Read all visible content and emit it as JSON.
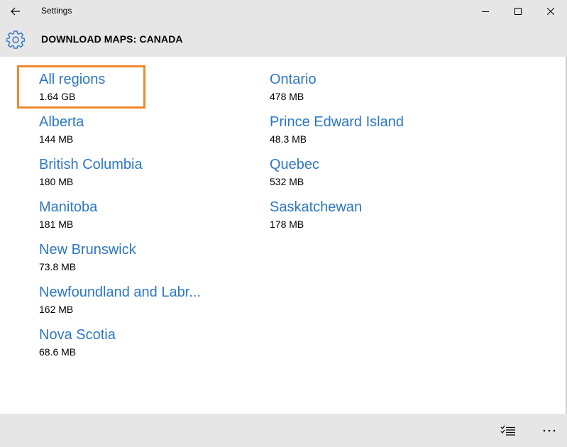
{
  "window": {
    "title": "Settings",
    "back_icon": "back-arrow-icon",
    "minimize_icon": "minimize-icon",
    "maximize_icon": "maximize-icon",
    "close_icon": "close-icon"
  },
  "header": {
    "icon": "gear-icon",
    "title": "DOWNLOAD MAPS: CANADA"
  },
  "regions": {
    "column1": [
      {
        "name": "All regions",
        "size": "1.64 GB",
        "focused": true
      },
      {
        "name": "Alberta",
        "size": "144 MB"
      },
      {
        "name": "British Columbia",
        "size": "180 MB"
      },
      {
        "name": "Manitoba",
        "size": "181 MB"
      },
      {
        "name": "New Brunswick",
        "size": "73.8 MB"
      },
      {
        "name": "Newfoundland and Labr...",
        "size": "162 MB"
      },
      {
        "name": "Nova Scotia",
        "size": "68.6 MB"
      }
    ],
    "column2": [
      {
        "name": "Ontario",
        "size": "478 MB"
      },
      {
        "name": "Prince Edward Island",
        "size": "48.3 MB"
      },
      {
        "name": "Quebec",
        "size": "532 MB"
      },
      {
        "name": "Saskatchewan",
        "size": "178 MB"
      }
    ]
  },
  "appbar": {
    "select_icon": "select-list-icon",
    "more_icon": "more-ellipsis-icon",
    "more_label": "..."
  },
  "colors": {
    "accent": "#2d77c5",
    "focus": "#f0882b",
    "chrome": "#e6e6e6"
  }
}
